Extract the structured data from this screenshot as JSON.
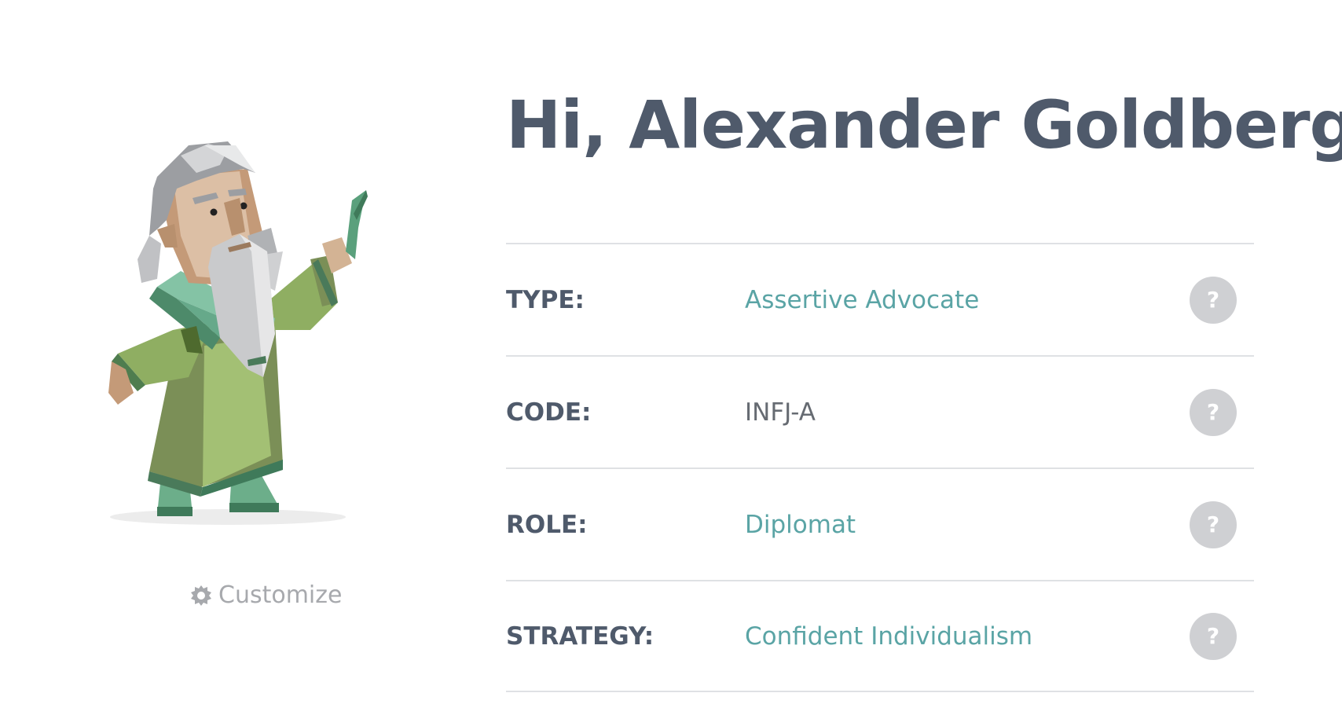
{
  "header": {
    "title": "Hi, Alexander Goldberg!"
  },
  "avatar": {
    "customize_label": "Customize"
  },
  "profile": {
    "rows": [
      {
        "label": "TYPE:",
        "value": "Assertive Advocate",
        "help": "?"
      },
      {
        "label": "CODE:",
        "value": "INFJ-A",
        "help": "?"
      },
      {
        "label": "ROLE:",
        "value": "Diplomat",
        "help": "?"
      },
      {
        "label": "STRATEGY:",
        "value": "Confident Individualism",
        "help": "?"
      }
    ]
  },
  "colors": {
    "heading": "#4f5a6b",
    "accent": "#5aa4a5",
    "muted": "#a7a9ad",
    "divider": "#dfe1e4",
    "help_bg": "#cfd0d3"
  }
}
